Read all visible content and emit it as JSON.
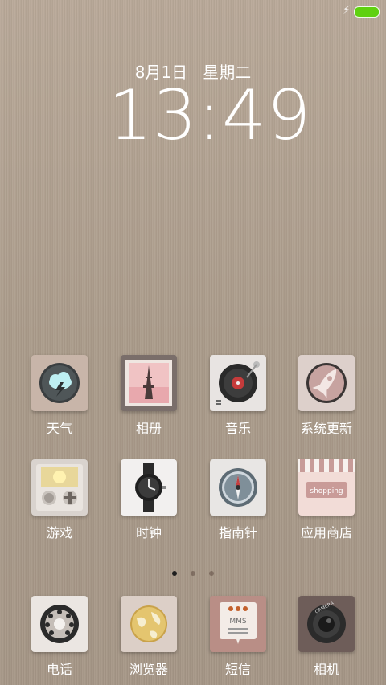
{
  "status_bar": {
    "charging_symbol": "⚡",
    "battery_color": "#5fd10f"
  },
  "lockscreen": {
    "date": "8月1日",
    "weekday": "星期二",
    "time": "13:49"
  },
  "apps_row1": [
    {
      "label": "天气",
      "icon": "weather-icon"
    },
    {
      "label": "相册",
      "icon": "gallery-icon"
    },
    {
      "label": "音乐",
      "icon": "music-icon"
    },
    {
      "label": "系统更新",
      "icon": "system-update-icon"
    }
  ],
  "apps_row2": [
    {
      "label": "游戏",
      "icon": "game-icon"
    },
    {
      "label": "时钟",
      "icon": "clock-icon"
    },
    {
      "label": "指南针",
      "icon": "compass-icon"
    },
    {
      "label": "应用商店",
      "icon": "app-store-icon",
      "sign": "shopping"
    }
  ],
  "dock": [
    {
      "label": "电话",
      "icon": "phone-icon"
    },
    {
      "label": "浏览器",
      "icon": "browser-icon"
    },
    {
      "label": "短信",
      "icon": "sms-icon",
      "sign": "MMS"
    },
    {
      "label": "相机",
      "icon": "camera-icon",
      "sign": "CAMERA"
    }
  ],
  "page_indicator": {
    "pages": 3,
    "active": 0
  }
}
